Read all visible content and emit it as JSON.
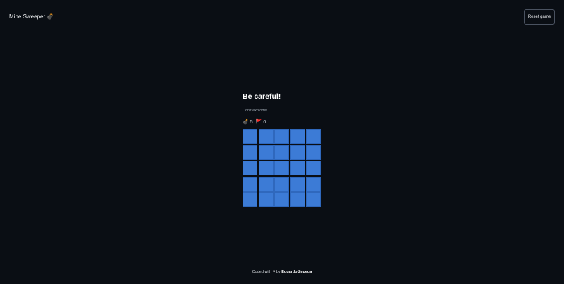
{
  "header": {
    "app_title": "Mine Sweeper",
    "app_icon": "💣",
    "reset_label": "Reset game"
  },
  "game": {
    "title": "Be careful!",
    "subtitle": "Don't explode!",
    "mines_icon": "💣",
    "mines_count": "5",
    "flags_icon": "🚩",
    "flags_count": "0",
    "rows": 5,
    "cols": 5,
    "cell_color": "#3c7bd6"
  },
  "footer": {
    "prefix": "Coded with",
    "heart_icon": "♥",
    "by": "by",
    "author": "Eduardo Zepeda"
  }
}
